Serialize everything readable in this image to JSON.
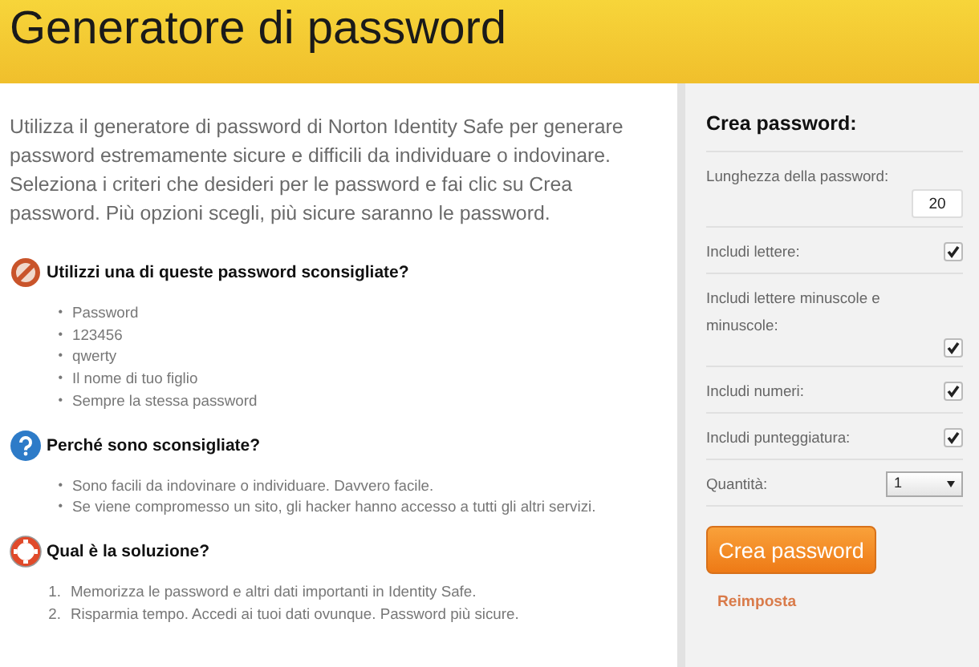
{
  "header": {
    "title": "Generatore di password"
  },
  "intro": "Utilizza il generatore di password di Norton Identity Safe per generare password estremamente sicure e difficili da individuare o indovinare. Seleziona i criteri che desideri per le password e fai clic su Crea password. Più opzioni scegli, più sicure saranno le password.",
  "sections": [
    {
      "heading": "Utilizzi una di queste password sconsigliate?",
      "items": [
        {
          "marker": "•",
          "text": "Password"
        },
        {
          "marker": "•",
          "text": "123456"
        },
        {
          "marker": "•",
          "text": "qwerty"
        },
        {
          "marker": "•",
          "text": "Il nome di tuo figlio"
        },
        {
          "marker": "•",
          "text": "Sempre la stessa password"
        }
      ]
    },
    {
      "heading": "Perché sono sconsigliate?",
      "items": [
        {
          "marker": "•",
          "text": "Sono facili da indovinare o individuare. Davvero facile."
        },
        {
          "marker": "•",
          "text": "Se viene compromesso un sito, gli hacker hanno accesso a tutti gli altri servizi."
        }
      ]
    },
    {
      "heading": "Qual è la soluzione?",
      "items": [
        {
          "marker": "1.",
          "text": "Memorizza le password e altri dati importanti in Identity Safe."
        },
        {
          "marker": "2.",
          "text": "Risparmia tempo. Accedi ai tuoi dati ovunque. Password più sicure."
        }
      ]
    }
  ],
  "panel": {
    "title": "Crea password:",
    "options": [
      {
        "kind": "number",
        "label": "Lunghezza della password:",
        "value": "20"
      },
      {
        "kind": "checkbox",
        "label": "Includi lettere:",
        "checked": true
      },
      {
        "kind": "checkbox",
        "label": "Includi lettere minuscole e minuscole:",
        "checked": true
      },
      {
        "kind": "checkbox",
        "label": "Includi numeri:",
        "checked": true
      },
      {
        "kind": "checkbox",
        "label": "Includi punteggiatura:",
        "checked": true
      },
      {
        "kind": "select",
        "label": "Quantità:",
        "value": "1"
      }
    ],
    "button": "Crea password",
    "reset": "Reimposta"
  }
}
